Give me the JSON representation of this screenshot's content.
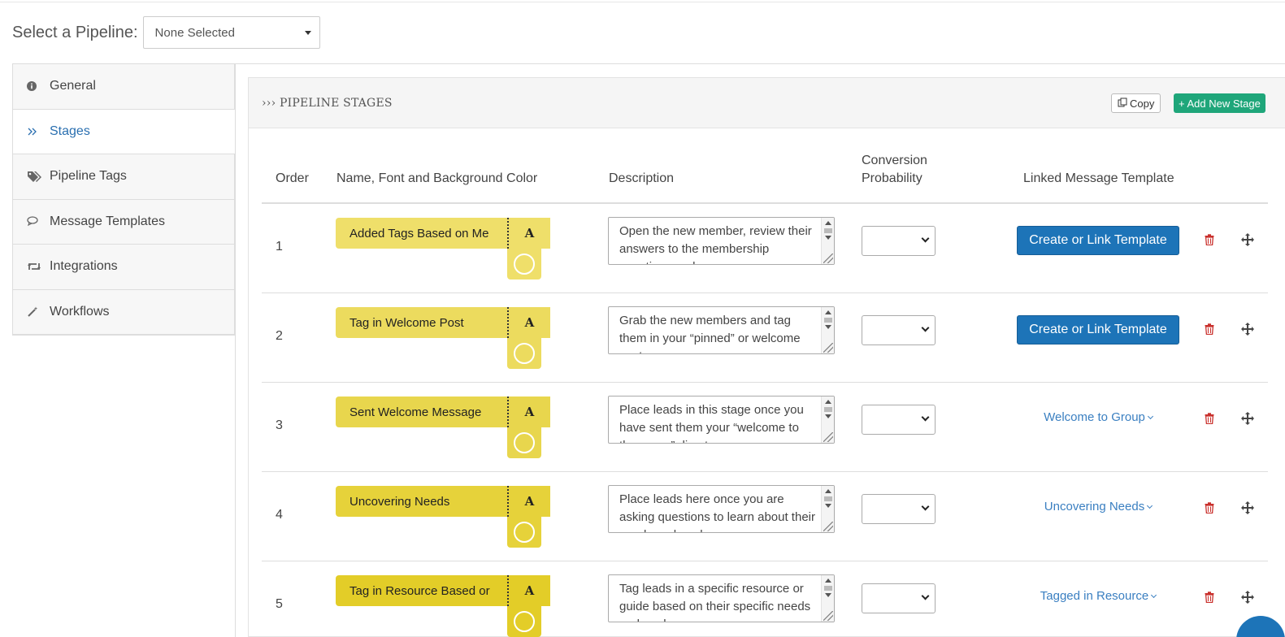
{
  "pipeline": {
    "label": "Select a Pipeline:",
    "selected": "None Selected"
  },
  "sidebar": {
    "items": [
      {
        "label": "General",
        "icon": "info-icon",
        "active": false
      },
      {
        "label": "Stages",
        "icon": "chevrons-right-icon",
        "active": true
      },
      {
        "label": "Pipeline Tags",
        "icon": "tags-icon",
        "active": false
      },
      {
        "label": "Message Templates",
        "icon": "chat-icon",
        "active": false
      },
      {
        "label": "Integrations",
        "icon": "retweet-icon",
        "active": false
      },
      {
        "label": "Workflows",
        "icon": "magic-wand-icon",
        "active": false
      }
    ]
  },
  "panel": {
    "title": "››› PIPELINE STAGES",
    "copy_label": "Copy",
    "add_label": "+ Add New Stage"
  },
  "table": {
    "headers": {
      "order": "Order",
      "name": "Name, Font and Background Color",
      "description": "Description",
      "probability_line1": "Conversion",
      "probability_line2": "Probability",
      "template": "Linked Message Template"
    },
    "font_glyph": "A",
    "rows": [
      {
        "order": "1",
        "name": "Added Tags Based on Me",
        "color": "#efdf6a",
        "description": "Open the new member, review their answers to the membership questions and",
        "template_button": "Create or Link Template",
        "template_link": ""
      },
      {
        "order": "2",
        "name": "Tag in Welcome Post",
        "color": "#ecdb5e",
        "description": "Grab the new members and tag them in your “pinned” or welcome post",
        "template_button": "Create or Link Template",
        "template_link": ""
      },
      {
        "order": "3",
        "name": "Sent Welcome Message",
        "color": "#e8d64d",
        "description": "Place leads in this stage once you have sent them your “welcome to the group” direct",
        "template_button": "",
        "template_link": "Welcome to Group"
      },
      {
        "order": "4",
        "name": "Uncovering Needs",
        "color": "#e6d23a",
        "description": "Place leads here once you are asking questions to learn about their needs and goals",
        "template_button": "",
        "template_link": "Uncovering Needs"
      },
      {
        "order": "5",
        "name": "Tag in Resource Based or",
        "color": "#e3cd28",
        "description": "Tag leads in a specific resource or guide based on their specific needs and goals",
        "template_button": "",
        "template_link": "Tagged in Resource"
      }
    ]
  },
  "colors": {
    "accent_blue": "#1d74b8",
    "add_green": "#1fa67a",
    "trash_red": "#c9302c"
  }
}
